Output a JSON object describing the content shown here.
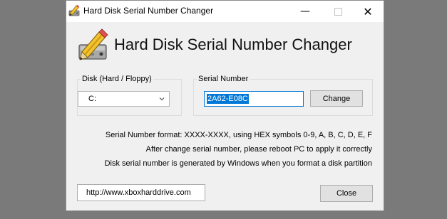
{
  "window": {
    "title": "Hard Disk Serial Number Changer",
    "icon": "pencil-disk-icon"
  },
  "titlebar_buttons": {
    "minimize": "—",
    "close": "✕"
  },
  "app": {
    "title": "Hard Disk Serial Number Changer",
    "logo": "pencil-disk-icon"
  },
  "disk_group": {
    "legend": "Disk (Hard / Floppy)",
    "selected": "C:"
  },
  "serial_group": {
    "legend": "Serial Number",
    "value": "2A62-E08C",
    "change_label": "Change"
  },
  "info_lines": [
    "Serial Number format: XXXX-XXXX, using HEX symbols 0-9, A, B, C, D, E, F",
    "After change serial number, please reboot PC to apply it correctly",
    "Disk serial number is generated by Windows when you format a disk partition"
  ],
  "footer": {
    "url": "http://www.xboxharddrive.com",
    "close_label": "Close"
  },
  "colors": {
    "accent": "#0078d7",
    "window_bg": "#f0f0f0",
    "desktop_bg": "#7a7a7a"
  }
}
